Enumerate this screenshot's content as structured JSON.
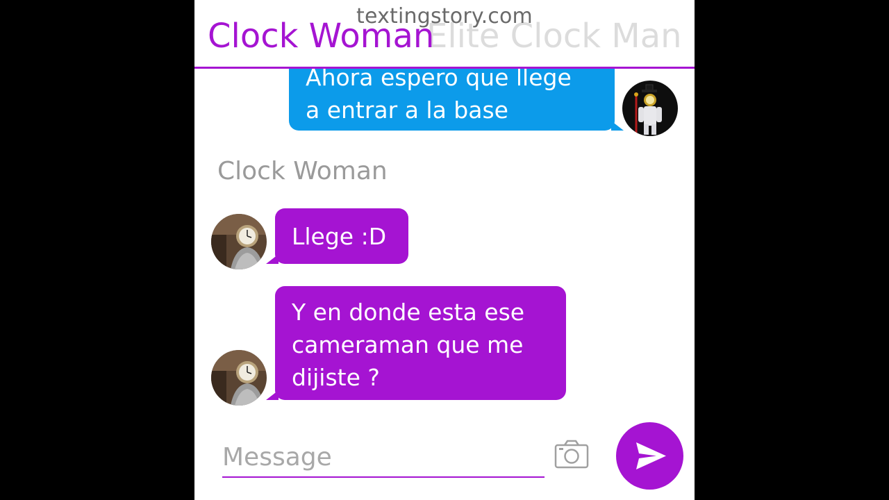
{
  "watermark": "textingstory.com",
  "header": {
    "title": "Clock Woman",
    "subtitle": "Elite Clock Man"
  },
  "messages": [
    {
      "direction": "outgoing",
      "lines": [
        "Ahora espero que llege",
        "a entrar a la base"
      ]
    },
    {
      "direction": "incoming",
      "text": "Llege :D"
    },
    {
      "direction": "incoming",
      "lines": [
        "Y en donde esta ese",
        "cameraman que me",
        "dijiste ?"
      ]
    }
  ],
  "sender_label": "Clock Woman",
  "composer": {
    "placeholder": "Message"
  },
  "icons": {
    "camera": "camera-icon",
    "send": "send-icon"
  },
  "colors": {
    "accent": "#a514d2",
    "outgoing_bubble": "#0c9bea",
    "muted_text": "#9a9a9a"
  }
}
